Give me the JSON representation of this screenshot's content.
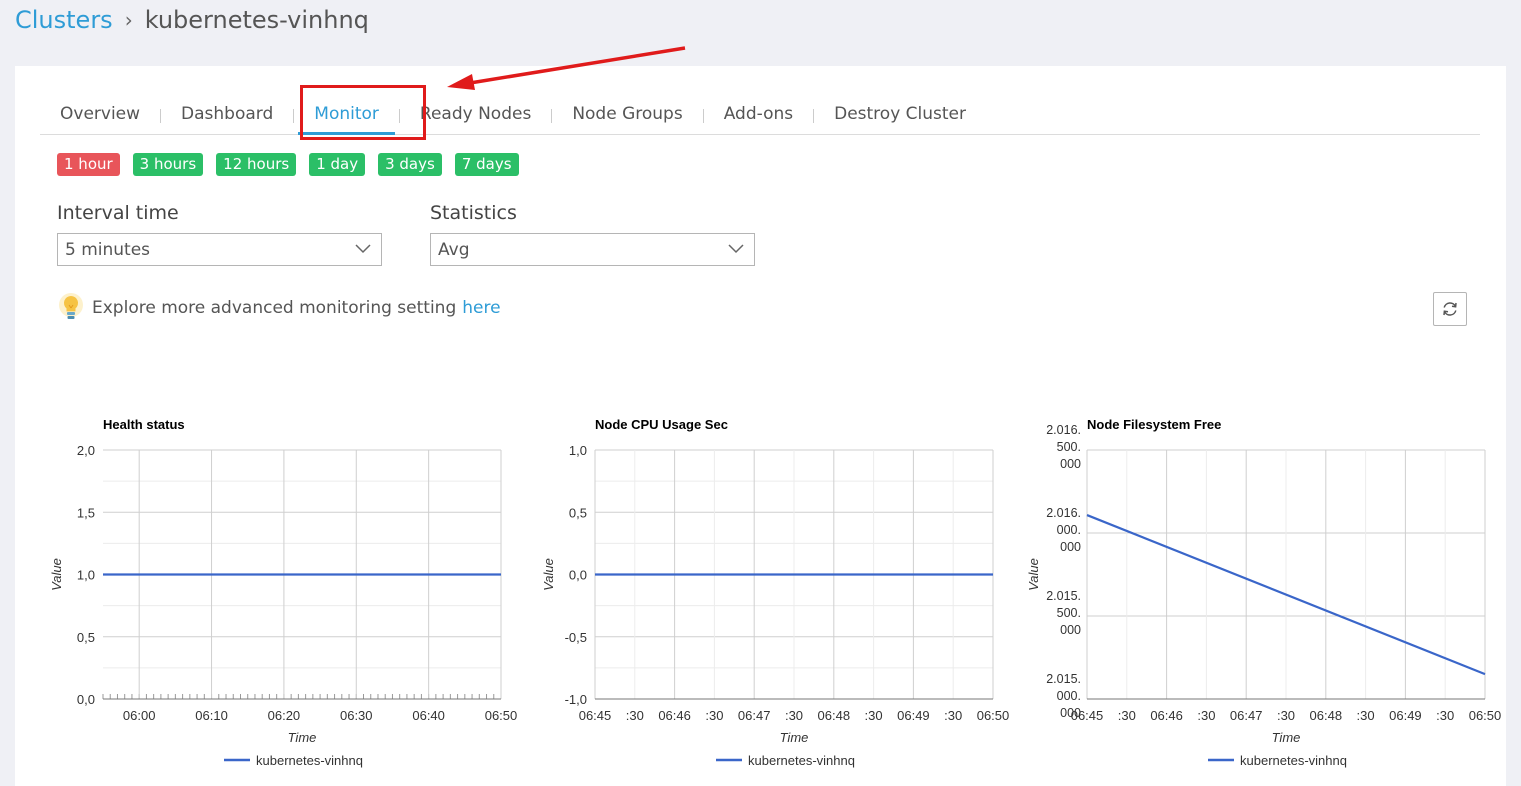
{
  "breadcrumb": {
    "root": "Clusters",
    "separator": "›",
    "current": "kubernetes-vinhnq"
  },
  "tabs": [
    {
      "label": "Overview",
      "active": false
    },
    {
      "label": "Dashboard",
      "active": false
    },
    {
      "label": "Monitor",
      "active": true
    },
    {
      "label": "Ready Nodes",
      "active": false
    },
    {
      "label": "Node Groups",
      "active": false
    },
    {
      "label": "Add-ons",
      "active": false
    },
    {
      "label": "Destroy Cluster",
      "active": false
    }
  ],
  "time_ranges": [
    {
      "label": "1 hour",
      "active": true
    },
    {
      "label": "3 hours",
      "active": false
    },
    {
      "label": "12 hours",
      "active": false
    },
    {
      "label": "1 day",
      "active": false
    },
    {
      "label": "3 days",
      "active": false
    },
    {
      "label": "7 days",
      "active": false
    }
  ],
  "interval": {
    "label": "Interval time",
    "value": "5 minutes"
  },
  "statistics": {
    "label": "Statistics",
    "value": "Avg"
  },
  "tip": {
    "text": "Explore more advanced monitoring setting",
    "link": "here"
  },
  "icons": {
    "refresh": "refresh-icon",
    "bulb": "lightbulb-icon",
    "chevron": "chevron-down-icon",
    "arrow": "annotation-arrow"
  },
  "colors": {
    "accent": "#2e9cd6",
    "active_range": "#e8555a",
    "range": "#2bbf67",
    "series": "#3a66c9",
    "annotation": "#e01b1b"
  },
  "chart_data": [
    {
      "type": "line",
      "title": "Health status",
      "xlabel": "Time",
      "ylabel": "Value",
      "x": [
        "05:55",
        "06:50"
      ],
      "xticks": [
        "06:00",
        "06:10",
        "06:20",
        "06:30",
        "06:40",
        "06:50"
      ],
      "yticks": [
        "2,0",
        "1,5",
        "1,0",
        "0,5",
        "0,0"
      ],
      "ylim": [
        0,
        2
      ],
      "series": [
        {
          "name": "kubernetes-vinhnq",
          "values": [
            1,
            1
          ]
        }
      ],
      "grid": true,
      "legend": "bottom"
    },
    {
      "type": "line",
      "title": "Node CPU Usage Sec",
      "xlabel": "Time",
      "ylabel": "Value",
      "x": [
        "06:45",
        "06:50"
      ],
      "xticks": [
        "06:45",
        ":30",
        "06:46",
        ":30",
        "06:47",
        ":30",
        "06:48",
        ":30",
        "06:49",
        ":30",
        "06:50"
      ],
      "yticks": [
        "1,0",
        "0,5",
        "0,0",
        "-0,5",
        "-1,0"
      ],
      "ylim": [
        -1,
        1
      ],
      "series": [
        {
          "name": "kubernetes-vinhnq",
          "values": [
            0,
            0
          ]
        }
      ],
      "grid": true,
      "legend": "bottom"
    },
    {
      "type": "line",
      "title": "Node Filesystem Free",
      "xlabel": "Time",
      "ylabel": "Value",
      "x": [
        "06:45",
        "06:50"
      ],
      "xticks": [
        "06:45",
        ":30",
        "06:46",
        ":30",
        "06:47",
        ":30",
        "06:48",
        ":30",
        "06:49",
        ":30",
        "06:50"
      ],
      "yticks": [
        [
          "2.016.",
          "500.",
          "000"
        ],
        [
          "2.016.",
          "000.",
          "000"
        ],
        [
          "2.015.",
          "500.",
          "000"
        ],
        [
          "2.015.",
          "000.",
          "000"
        ]
      ],
      "ylim": [
        2015000000,
        2016500000
      ],
      "series": [
        {
          "name": "kubernetes-vinhnq",
          "values": [
            2016108000,
            2015150000
          ]
        }
      ],
      "grid": true,
      "legend": "bottom"
    }
  ]
}
